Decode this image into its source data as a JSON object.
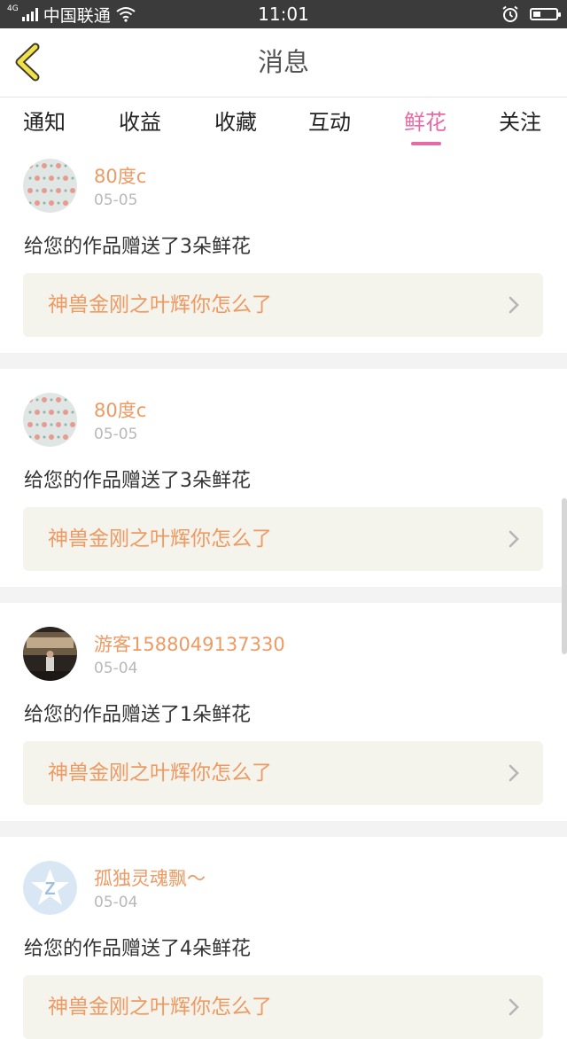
{
  "status_bar": {
    "network": "4G",
    "carrier": "中国联通",
    "time": "11:01",
    "icons": [
      "signal-icon",
      "wifi-icon",
      "alarm-icon",
      "battery-icon"
    ]
  },
  "nav": {
    "title": "消息",
    "back_icon": "chevron-left-icon"
  },
  "tabs": [
    {
      "label": "通知"
    },
    {
      "label": "收益"
    },
    {
      "label": "收藏"
    },
    {
      "label": "互动"
    },
    {
      "label": "鲜花"
    },
    {
      "label": "关注"
    }
  ],
  "active_tab": "鲜花",
  "colors": {
    "accent": "#e56aa5",
    "username": "#ed9a63",
    "link_bg": "#f4f3ec",
    "status_bar": "#3b3b3b"
  },
  "messages": [
    {
      "username": "80度c",
      "date": "05-05",
      "text": "给您的作品赠送了3朵鲜花",
      "work_title": "神兽金刚之叶辉你怎么了",
      "avatar": "floral-pattern"
    },
    {
      "username": "80度c",
      "date": "05-05",
      "text": "给您的作品赠送了3朵鲜花",
      "work_title": "神兽金刚之叶辉你怎么了",
      "avatar": "floral-pattern"
    },
    {
      "username": "游客1588049137330",
      "date": "05-04",
      "text": "给您的作品赠送了1朵鲜花",
      "work_title": "神兽金刚之叶辉你怎么了",
      "avatar": "photo"
    },
    {
      "username": "孤独灵魂飘～",
      "date": "05-04",
      "text": "给您的作品赠送了4朵鲜花",
      "work_title": "神兽金刚之叶辉你怎么了",
      "avatar": "qq-default"
    }
  ]
}
